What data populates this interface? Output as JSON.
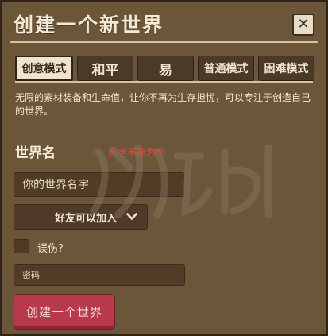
{
  "dialog": {
    "title": "创建一个新世界",
    "close_icon": "close-icon"
  },
  "tabs": [
    {
      "label": "创意模式",
      "active": true
    },
    {
      "label": "和平",
      "active": false
    },
    {
      "label": "易",
      "active": false
    },
    {
      "label": "普通模式",
      "active": false
    },
    {
      "label": "困难模式",
      "active": false
    }
  ],
  "description": "无限的素材装备和生命值，让你不再为生存担忧，可以专注于创造自己的世界。",
  "world_name": {
    "label": "世界名",
    "error": "名字不能为空",
    "placeholder": "你的世界名字",
    "value": ""
  },
  "access": {
    "selected": "好友可以加入",
    "icon": "chevron-down-icon"
  },
  "friendly_fire": {
    "label": "误伤?",
    "checked": false
  },
  "password": {
    "placeholder": "密码",
    "value": ""
  },
  "create_button": "创建一个世界",
  "colors": {
    "panel": "#6b563a",
    "accent_rule": "#d6c49d",
    "error": "#d8433c",
    "create_button": "#b8394c"
  }
}
